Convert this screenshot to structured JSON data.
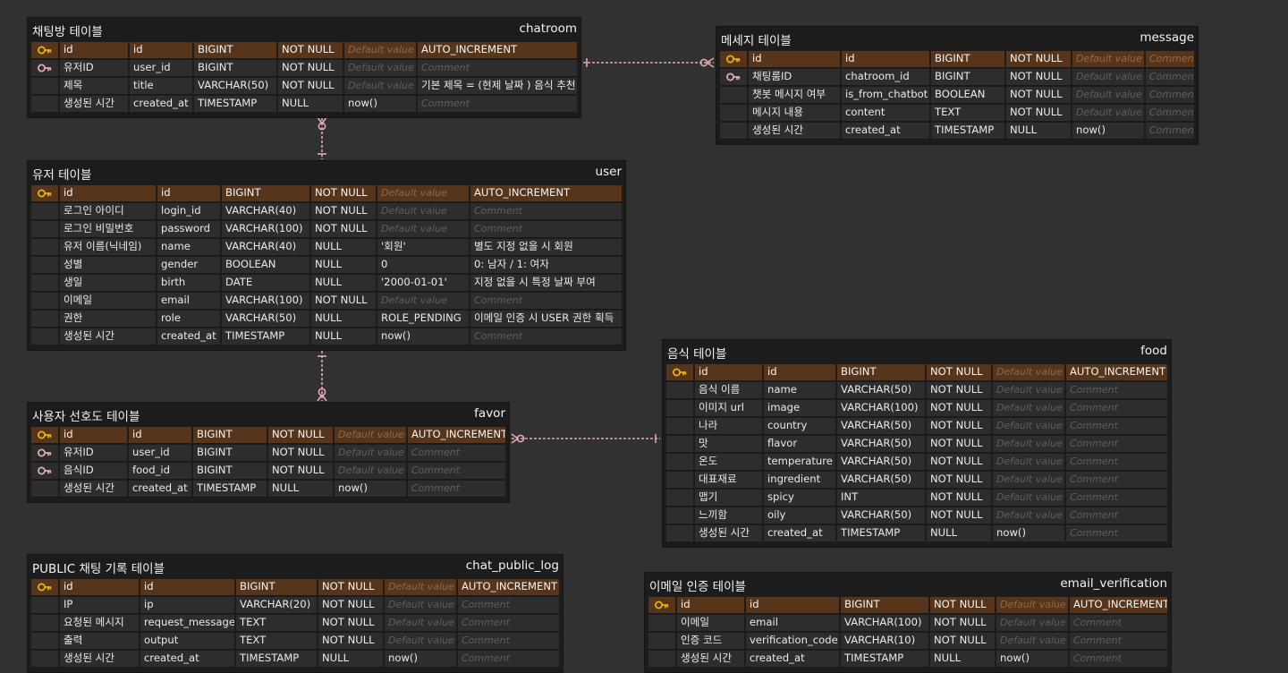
{
  "colors": {
    "background": "#313131",
    "pk_row": "#56351b",
    "row": "#2d2d2d",
    "table": "#1c1c1c",
    "relation_line": "#e0aab4",
    "key_icon_pk": "#e8b20c",
    "key_icon_fk": "#e0aab4"
  },
  "placeholders": {
    "default": "Default value",
    "comment": "Comment"
  },
  "tables": [
    {
      "id": "chatroom",
      "display_name": "채팅방 테이블",
      "physical_name": "chatroom",
      "columns": [
        {
          "key": "pk",
          "logical": "id",
          "physical": "id",
          "type": "BIGINT",
          "nullability": "NOT NULL",
          "default": null,
          "comment": "AUTO_INCREMENT"
        },
        {
          "key": "fk",
          "logical": "유저ID",
          "physical": "user_id",
          "type": "BIGINT",
          "nullability": "NOT NULL",
          "default": null,
          "comment": null
        },
        {
          "key": "",
          "logical": "제목",
          "physical": "title",
          "type": "VARCHAR(50)",
          "nullability": "NOT NULL",
          "default": null,
          "comment": "기본 제목 = (현제 날짜 ) 음식 추천"
        },
        {
          "key": "",
          "logical": "생성된 시간",
          "physical": "created_at",
          "type": "TIMESTAMP",
          "nullability": "NULL",
          "default": "now()",
          "comment": null
        }
      ]
    },
    {
      "id": "message",
      "display_name": "메세지 테이블",
      "physical_name": "message",
      "columns": [
        {
          "key": "pk",
          "logical": "id",
          "physical": "id",
          "type": "BIGINT",
          "nullability": "NOT NULL",
          "default": null,
          "comment": null
        },
        {
          "key": "fk",
          "logical": "채팅룸ID",
          "physical": "chatroom_id",
          "type": "BIGINT",
          "nullability": "NOT NULL",
          "default": null,
          "comment": null
        },
        {
          "key": "",
          "logical": "챗봇 메시지 여부",
          "physical": "is_from_chatbot",
          "type": "BOOLEAN",
          "nullability": "NOT NULL",
          "default": null,
          "comment": null
        },
        {
          "key": "",
          "logical": "메시지 내용",
          "physical": "content",
          "type": "TEXT",
          "nullability": "NOT NULL",
          "default": null,
          "comment": null
        },
        {
          "key": "",
          "logical": "생성된 시간",
          "physical": "created_at",
          "type": "TIMESTAMP",
          "nullability": "NULL",
          "default": "now()",
          "comment": null
        }
      ]
    },
    {
      "id": "user",
      "display_name": "유저 테이블",
      "physical_name": "user",
      "columns": [
        {
          "key": "pk",
          "logical": "id",
          "physical": "id",
          "type": "BIGINT",
          "nullability": "NOT NULL",
          "default": null,
          "comment": "AUTO_INCREMENT"
        },
        {
          "key": "",
          "logical": "로그인 아이디",
          "physical": "login_id",
          "type": "VARCHAR(40)",
          "nullability": "NOT NULL",
          "default": null,
          "comment": null
        },
        {
          "key": "",
          "logical": "로그인 비밀번호",
          "physical": "password",
          "type": "VARCHAR(100)",
          "nullability": "NOT NULL",
          "default": null,
          "comment": null
        },
        {
          "key": "",
          "logical": "유저 이름(닉네임)",
          "physical": "name",
          "type": "VARCHAR(40)",
          "nullability": "NULL",
          "default": "'회원'",
          "comment": "별도 지정 없을 시 회원"
        },
        {
          "key": "",
          "logical": "성별",
          "physical": "gender",
          "type": "BOOLEAN",
          "nullability": "NULL",
          "default": "0",
          "comment": "0: 남자 / 1: 여자"
        },
        {
          "key": "",
          "logical": "생일",
          "physical": "birth",
          "type": "DATE",
          "nullability": "NULL",
          "default": "'2000-01-01'",
          "comment": "지정 없을 시 특정 날짜 부여"
        },
        {
          "key": "",
          "logical": "이메일",
          "physical": "email",
          "type": "VARCHAR(100)",
          "nullability": "NOT NULL",
          "default": null,
          "comment": null
        },
        {
          "key": "",
          "logical": "권한",
          "physical": "role",
          "type": "VARCHAR(50)",
          "nullability": "NULL",
          "default": "ROLE_PENDING",
          "comment": "이메일 인증 시 USER 권한 획득"
        },
        {
          "key": "",
          "logical": "생성된 시간",
          "physical": "created_at",
          "type": "TIMESTAMP",
          "nullability": "NULL",
          "default": "now()",
          "comment": null
        }
      ]
    },
    {
      "id": "food",
      "display_name": "음식 테이블",
      "physical_name": "food",
      "columns": [
        {
          "key": "pk",
          "logical": "id",
          "physical": "id",
          "type": "BIGINT",
          "nullability": "NOT NULL",
          "default": null,
          "comment": "AUTO_INCREMENT"
        },
        {
          "key": "",
          "logical": "음식 이름",
          "physical": "name",
          "type": "VARCHAR(50)",
          "nullability": "NOT NULL",
          "default": null,
          "comment": null
        },
        {
          "key": "",
          "logical": "이미지 url",
          "physical": "image",
          "type": "VARCHAR(100)",
          "nullability": "NOT NULL",
          "default": null,
          "comment": null
        },
        {
          "key": "",
          "logical": "나라",
          "physical": "country",
          "type": "VARCHAR(50)",
          "nullability": "NOT NULL",
          "default": null,
          "comment": null
        },
        {
          "key": "",
          "logical": "맛",
          "physical": "flavor",
          "type": "VARCHAR(50)",
          "nullability": "NOT NULL",
          "default": null,
          "comment": null
        },
        {
          "key": "",
          "logical": "온도",
          "physical": "temperature",
          "type": "VARCHAR(50)",
          "nullability": "NOT NULL",
          "default": null,
          "comment": null
        },
        {
          "key": "",
          "logical": "대표재료",
          "physical": "ingredient",
          "type": "VARCHAR(50)",
          "nullability": "NOT NULL",
          "default": null,
          "comment": null
        },
        {
          "key": "",
          "logical": "맵기",
          "physical": "spicy",
          "type": "INT",
          "nullability": "NOT NULL",
          "default": null,
          "comment": null
        },
        {
          "key": "",
          "logical": "느끼함",
          "physical": "oily",
          "type": "VARCHAR(50)",
          "nullability": "NOT NULL",
          "default": null,
          "comment": null
        },
        {
          "key": "",
          "logical": "생성된 시간",
          "physical": "created_at",
          "type": "TIMESTAMP",
          "nullability": "NULL",
          "default": "now()",
          "comment": null
        }
      ]
    },
    {
      "id": "favor",
      "display_name": "사용자 선호도 테이블",
      "physical_name": "favor",
      "columns": [
        {
          "key": "pk",
          "logical": "id",
          "physical": "id",
          "type": "BIGINT",
          "nullability": "NOT NULL",
          "default": null,
          "comment": "AUTO_INCREMENT"
        },
        {
          "key": "fk",
          "logical": "유저ID",
          "physical": "user_id",
          "type": "BIGINT",
          "nullability": "NOT NULL",
          "default": null,
          "comment": null
        },
        {
          "key": "fk",
          "logical": "음식ID",
          "physical": "food_id",
          "type": "BIGINT",
          "nullability": "NOT NULL",
          "default": null,
          "comment": null
        },
        {
          "key": "",
          "logical": "생성된 시간",
          "physical": "created_at",
          "type": "TIMESTAMP",
          "nullability": "NULL",
          "default": "now()",
          "comment": null
        }
      ]
    },
    {
      "id": "chat_public_log",
      "display_name": "PUBLIC 채팅 기록 테이블",
      "physical_name": "chat_public_log",
      "columns": [
        {
          "key": "pk",
          "logical": "id",
          "physical": "id",
          "type": "BIGINT",
          "nullability": "NOT NULL",
          "default": null,
          "comment": "AUTO_INCREMENT"
        },
        {
          "key": "",
          "logical": "IP",
          "physical": "ip",
          "type": "VARCHAR(20)",
          "nullability": "NOT NULL",
          "default": null,
          "comment": null
        },
        {
          "key": "",
          "logical": "요청된 메시지",
          "physical": "request_message",
          "type": "TEXT",
          "nullability": "NOT NULL",
          "default": null,
          "comment": null
        },
        {
          "key": "",
          "logical": "출력",
          "physical": "output",
          "type": "TEXT",
          "nullability": "NOT NULL",
          "default": null,
          "comment": null
        },
        {
          "key": "",
          "logical": "생성된 시간",
          "physical": "created_at",
          "type": "TIMESTAMP",
          "nullability": "NULL",
          "default": "now()",
          "comment": null
        }
      ]
    },
    {
      "id": "email_verification",
      "display_name": "이메일 인증 테이블",
      "physical_name": "email_verification",
      "columns": [
        {
          "key": "pk",
          "logical": "id",
          "physical": "id",
          "type": "BIGINT",
          "nullability": "NOT NULL",
          "default": null,
          "comment": "AUTO_INCREMENT"
        },
        {
          "key": "",
          "logical": "이메일",
          "physical": "email",
          "type": "VARCHAR(100)",
          "nullability": "NOT NULL",
          "default": null,
          "comment": null
        },
        {
          "key": "",
          "logical": "인증 코드",
          "physical": "verification_code",
          "type": "VARCHAR(10)",
          "nullability": "NOT NULL",
          "default": null,
          "comment": null
        },
        {
          "key": "",
          "logical": "생성된 시간",
          "physical": "created_at",
          "type": "TIMESTAMP",
          "nullability": "NULL",
          "default": "now()",
          "comment": null
        }
      ]
    }
  ],
  "relations": [
    {
      "from": "chatroom",
      "to": "message",
      "from_end": "one",
      "to_end": "zero-or-many"
    },
    {
      "from": "user",
      "to": "chatroom",
      "from_end": "one",
      "to_end": "zero-or-many"
    },
    {
      "from": "user",
      "to": "favor",
      "from_end": "one",
      "to_end": "zero-or-many"
    },
    {
      "from": "food",
      "to": "favor",
      "from_end": "one",
      "to_end": "zero-or-many"
    }
  ]
}
